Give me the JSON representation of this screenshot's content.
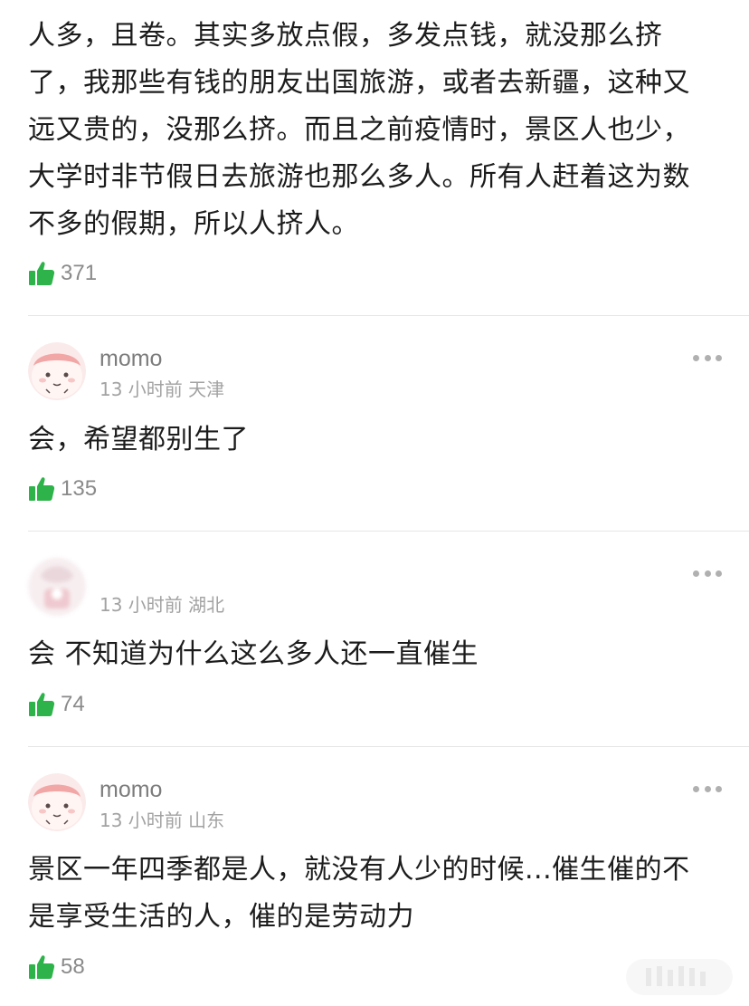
{
  "top_comment": {
    "text_lines": [
      "人多，且卷。其实多放点假，多发点钱，就没那么挤",
      "了，我那些有钱的朋友出国旅游，或者去新疆，这种又",
      "远又贵的，没那么挤。而且之前疫情时，景区人也少，",
      "大学时非节假日去旅游也那么多人。所有人赶着这为数",
      "不多的假期，所以人挤人。"
    ],
    "likes": "371"
  },
  "comments": [
    {
      "username": "momo",
      "time": "13 小时前",
      "location": "天津",
      "text_lines": [
        "会，希望都别生了"
      ],
      "likes": "135"
    },
    {
      "username": "",
      "time": "13 小时前",
      "location": "湖北",
      "text_lines": [
        "会 不知道为什么这么多人还一直催生"
      ],
      "likes": "74"
    },
    {
      "username": "momo",
      "time": "13 小时前",
      "location": "山东",
      "text_lines": [
        "景区一年四季都是人，就没有人少的时候...催生催的不",
        "是享受生活的人，催的是劳动力"
      ],
      "likes": "58"
    }
  ],
  "colors": {
    "like_icon": "#2db34a",
    "divider": "#e6e6e6",
    "meta_text": "#a2a2a2",
    "username_text": "#7c7c7c"
  },
  "icons": {
    "like": "thumbs-up-icon",
    "more": "more-dots-icon"
  }
}
